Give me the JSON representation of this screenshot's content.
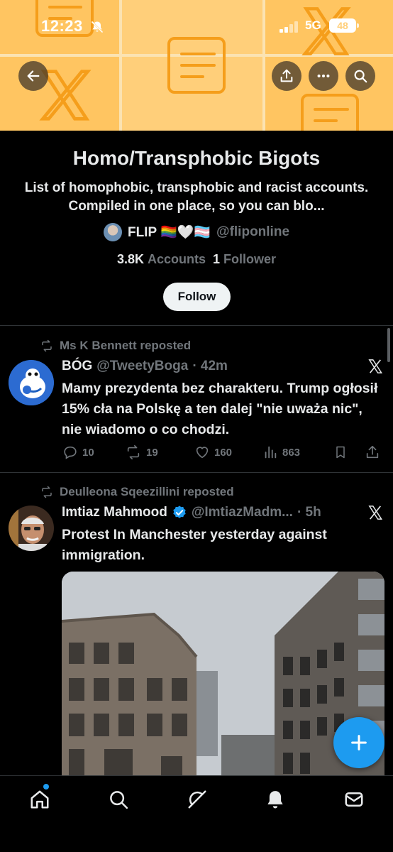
{
  "status_bar": {
    "time": "12:23",
    "network": "5G",
    "battery": "48"
  },
  "header": {
    "back_icon": "arrow-left-icon",
    "actions": [
      "share-icon",
      "more-icon",
      "search-icon"
    ]
  },
  "list": {
    "title": "Homo/Transphobic Bigots",
    "description": "List of homophobic, transphobic and racist accounts. Compiled in one place, so you can blo...",
    "owner_name": "FLIP 🏳️‍🌈🤍🏳️‍⚧️",
    "owner_handle": "@fliponline",
    "accounts_count": "3.8K",
    "accounts_label": "Accounts",
    "followers_count": "1",
    "followers_label": "Follower",
    "follow_label": "Follow"
  },
  "tweets": [
    {
      "reposted_by": "Ms K Bennett reposted",
      "name": "BÓG",
      "handle": "@TweetyBoga",
      "time": "· 42m",
      "text": "Mamy prezydenta bez charakteru. Trump ogłosił 15% cła na Polskę a ten dalej \"nie uważa nic\", nie wiadomo o co chodzi.",
      "replies": "10",
      "reposts": "19",
      "likes": "160",
      "views": "863"
    },
    {
      "reposted_by": "Deulleona Sqeezillini reposted",
      "name": "Imtiaz Mahmood",
      "handle": "@ImtiazMadm...",
      "time": "· 5h",
      "verified": true,
      "text": "Protest In Manchester yesterday against immigration."
    }
  ],
  "colors": {
    "accent": "#1d9bf0",
    "banner": "#ffcf7a",
    "banner_icon": "#f59e1b"
  },
  "tabbar": [
    "home-icon",
    "search-icon",
    "grok-icon",
    "notifications-icon",
    "messages-icon"
  ]
}
